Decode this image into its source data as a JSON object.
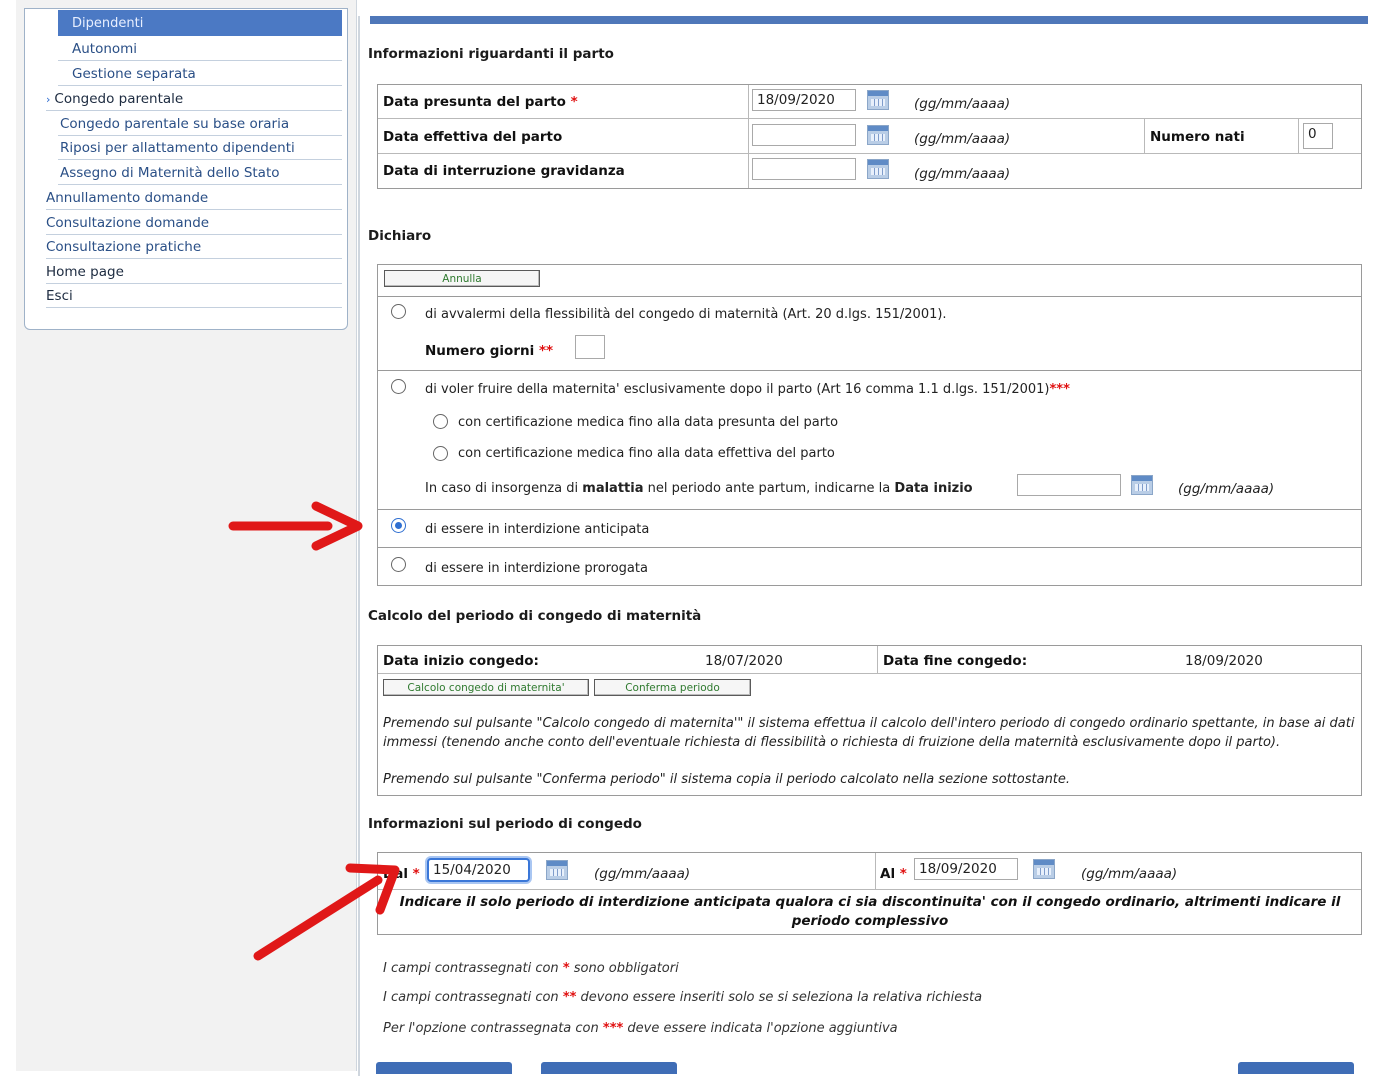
{
  "nav": {
    "selected": "Dipendenti",
    "items": [
      {
        "label": "Autonomi"
      },
      {
        "label": "Gestione separata"
      },
      {
        "label": "Congedo parentale"
      },
      {
        "label": "Congedo parentale su base oraria"
      },
      {
        "label": "Riposi per allattamento dipendenti"
      },
      {
        "label": "Assegno di Maternità dello Stato"
      },
      {
        "label": "Annullamento domande"
      },
      {
        "label": "Consultazione domande"
      },
      {
        "label": "Consultazione pratiche"
      },
      {
        "label": "Home page"
      },
      {
        "label": "Esci"
      }
    ]
  },
  "parto": {
    "title": "Informazioni riguardanti il parto",
    "presunta_label": "Data presunta del parto",
    "presunta_value": "18/09/2020",
    "effettiva_label": "Data effettiva del parto",
    "effettiva_value": "",
    "interruzione_label": "Data di interruzione gravidanza",
    "interruzione_value": "",
    "numero_nati_label": "Numero nati",
    "numero_nati_value": "0",
    "date_hint": "(gg/mm/aaaa)"
  },
  "dichiaro": {
    "title": "Dichiaro",
    "annulla_label": "Annulla",
    "opt1": "di avvalermi della flessibilità del congedo di maternità (Art. 20 d.lgs. 151/2001).",
    "numero_giorni_label": "Numero giorni",
    "opt2": "di voler fruire della maternita' esclusivamente dopo il parto (Art 16 comma 1.1 d.lgs. 151/2001)",
    "sub1": "con certificazione medica fino alla data presunta del parto",
    "sub2": "con certificazione medica fino alla data effettiva del parto",
    "malattia_pre": "In caso di insorgenza di ",
    "malattia_bold": "malattia",
    "malattia_mid": " nel periodo ante partum, indicarne la ",
    "malattia_bold2": "Data inizio",
    "opt3": "di essere in interdizione anticipata",
    "opt4": "di essere in interdizione prorogata"
  },
  "calcolo": {
    "title": "Calcolo del periodo di congedo di maternità",
    "inizio_label": "Data inizio congedo:",
    "inizio_value": "18/07/2020",
    "fine_label": "Data fine congedo:",
    "fine_value": "18/09/2020",
    "btn_calcolo": "Calcolo congedo di maternita'",
    "btn_conferma": "Conferma periodo",
    "note1": "Premendo sul pulsante \"Calcolo congedo di maternita'\" il sistema effettua il calcolo dell'intero periodo di congedo ordinario spettante, in base ai dati immessi (tenendo anche conto dell'eventuale richiesta di flessibilità o richiesta di fruizione della maternità esclusivamente dopo il parto).",
    "note2": "Premendo sul pulsante \"Conferma periodo\" il sistema copia il periodo calcolato nella sezione sottostante."
  },
  "periodo": {
    "title": "Informazioni sul periodo di congedo",
    "dal_label": "Dal",
    "dal_value": "15/04/2020",
    "al_label": "Al",
    "al_value": "18/09/2020",
    "warning": "Indicare il solo periodo di interdizione anticipata qualora ci sia discontinuita' con il congedo ordinario, altrimenti indicare il periodo complessivo"
  },
  "footer": {
    "line1_pre": "I campi contrassegnati con ",
    "line1_post": " sono obbligatori",
    "line2_pre": "I campi contrassegnati con ",
    "line2_post": " devono essere inseriti solo se si seleziona la relativa richiesta",
    "line3_pre": "Per l'opzione contrassegnata con ",
    "line3_post": " deve essere indicata l'opzione aggiuntiva"
  },
  "colors": {
    "accent": "#4f77b9",
    "required": "#e01010",
    "annotation_arrow": "#e01818"
  }
}
